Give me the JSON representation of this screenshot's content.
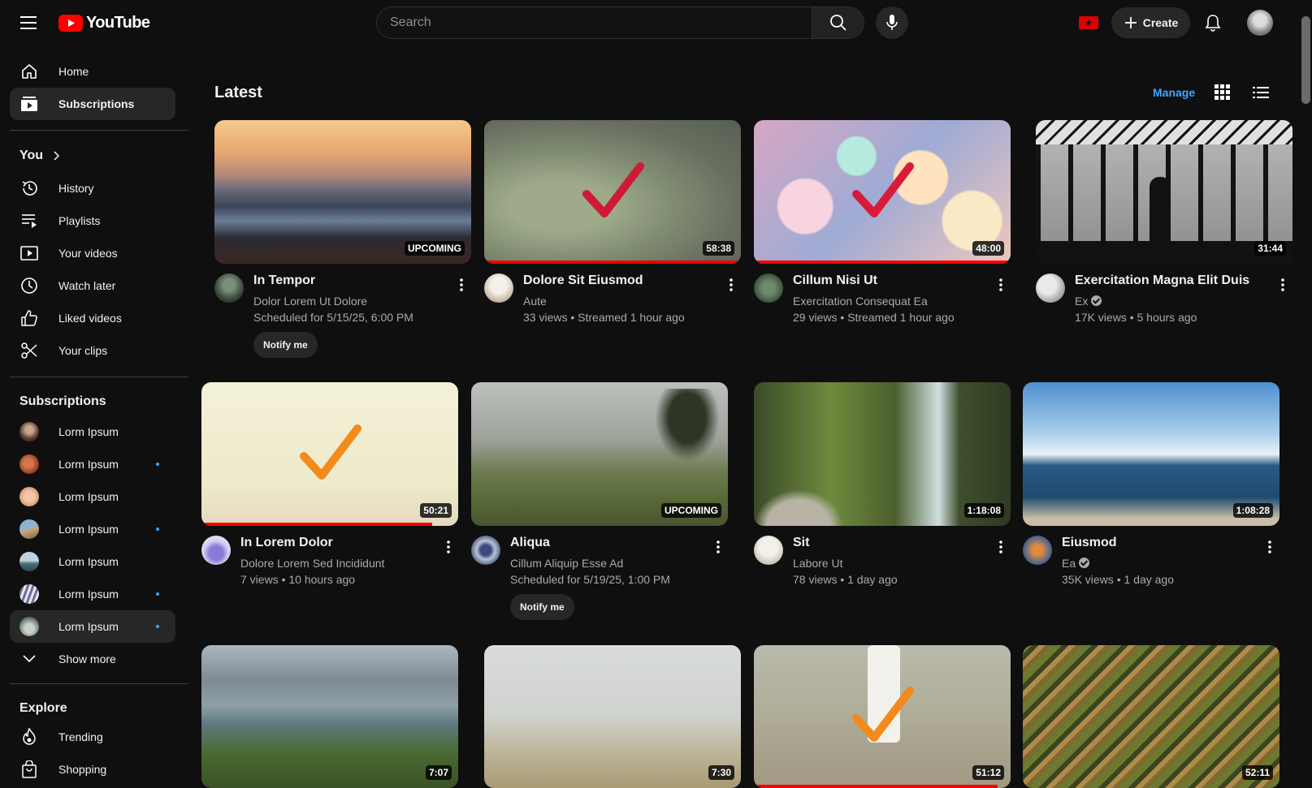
{
  "header": {
    "logo_text": "YouTube",
    "search_placeholder": "Search",
    "create_label": "Create"
  },
  "sidebar": {
    "main": [
      {
        "label": "Home",
        "icon": "home-icon"
      },
      {
        "label": "Subscriptions",
        "icon": "subscriptions-icon",
        "active": true
      }
    ],
    "you_title": "You",
    "you_items": [
      {
        "label": "History",
        "icon": "history-icon"
      },
      {
        "label": "Playlists",
        "icon": "playlists-icon"
      },
      {
        "label": "Your videos",
        "icon": "your-videos-icon"
      },
      {
        "label": "Watch later",
        "icon": "watch-later-icon"
      },
      {
        "label": "Liked videos",
        "icon": "liked-videos-icon"
      },
      {
        "label": "Your clips",
        "icon": "your-clips-icon"
      }
    ],
    "subscriptions_title": "Subscriptions",
    "subscriptions": [
      {
        "label": "Lorm Ipsum",
        "new": false
      },
      {
        "label": "Lorm Ipsum",
        "new": true
      },
      {
        "label": "Lorm Ipsum",
        "new": false
      },
      {
        "label": "Lorm Ipsum",
        "new": true
      },
      {
        "label": "Lorm Ipsum",
        "new": false
      },
      {
        "label": "Lorm Ipsum",
        "new": true
      },
      {
        "label": "Lorm Ipsum",
        "new": true,
        "active": true
      }
    ],
    "show_more": "Show more",
    "explore_title": "Explore",
    "explore_items": [
      {
        "label": "Trending",
        "icon": "trending-icon"
      },
      {
        "label": "Shopping",
        "icon": "shopping-icon"
      }
    ]
  },
  "main": {
    "section_title": "Latest",
    "manage_label": "Manage",
    "videos": [
      {
        "title": "In Tempor",
        "channel": "Dolor Lorem Ut Dolore",
        "stats": "Scheduled for 5/15/25, 6:00 PM",
        "badge": "UPCOMING",
        "button": "Notify me",
        "verified": false,
        "watched": false,
        "progress": 0
      },
      {
        "title": "Dolore Sit Eiusmod",
        "channel": "Aute",
        "stats": "33 views • Streamed 1 hour ago",
        "badge": "58:38",
        "verified": false,
        "watched": true,
        "progress": 1.0
      },
      {
        "title": "Cillum Nisi Ut",
        "channel": "Exercitation Consequat Ea",
        "stats": "29 views • Streamed 1 hour ago",
        "badge": "48:00",
        "verified": false,
        "watched": true,
        "progress": 1.0
      },
      {
        "title": "Exercitation Magna Elit Duis",
        "channel": "Ex",
        "stats": "17K views • 5 hours ago",
        "badge": "31:44",
        "verified": true,
        "watched": false,
        "progress": 0
      },
      {
        "title": "In Lorem Dolor",
        "channel": "Dolore Lorem Sed Incididunt",
        "stats": "7 views • 10 hours ago",
        "badge": "50:21",
        "verified": false,
        "watched": true,
        "progress": 0.9
      },
      {
        "title": "Aliqua",
        "channel": "Cillum Aliquip Esse Ad",
        "stats": "Scheduled for 5/19/25, 1:00 PM",
        "badge": "UPCOMING",
        "button": "Notify me",
        "verified": false,
        "watched": false,
        "progress": 0
      },
      {
        "title": "Sit",
        "channel": "Labore Ut",
        "stats": "78 views • 1 day ago",
        "badge": "1:18:08",
        "verified": false,
        "watched": false,
        "progress": 0
      },
      {
        "title": "Eiusmod",
        "channel": "Ea",
        "stats": "35K views • 1 day ago",
        "badge": "1:08:28",
        "verified": true,
        "watched": false,
        "progress": 0
      },
      {
        "badge": "7:07",
        "watched": false,
        "progress": 0
      },
      {
        "badge": "7:30",
        "watched": false,
        "progress": 0
      },
      {
        "badge": "51:12",
        "watched": true,
        "progress": 0.95
      },
      {
        "badge": "52:11",
        "watched": false,
        "progress": 0
      }
    ]
  },
  "colors": {
    "background": "#0f0f0f",
    "accent_red": "#ff0000",
    "link_blue": "#3ea6ff",
    "check_red": "#d81b3a",
    "check_orange": "#f28a1c"
  }
}
